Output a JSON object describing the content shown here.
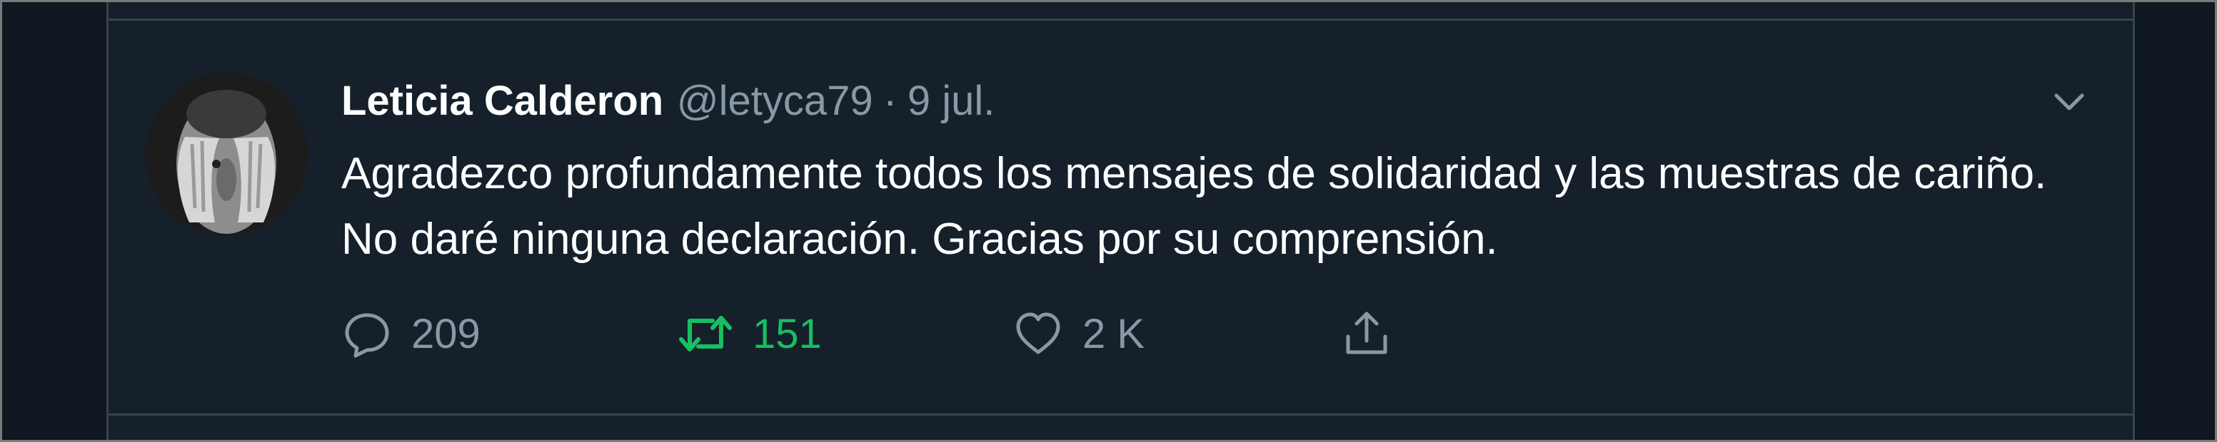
{
  "tweet": {
    "author_name": "Leticia Calderon",
    "handle": "@letyca79",
    "separator": "·",
    "date": "9 jul.",
    "text": "Agradezco profundamente todos los mensajes de solidaridad y las muestras de cariño. No daré ninguna declaración. Gracias por su comprensión."
  },
  "actions": {
    "reply": {
      "icon": "reply-icon",
      "count": "209",
      "color": "#8899a6"
    },
    "retweet": {
      "icon": "retweet-icon",
      "count": "151",
      "color": "#17bf63"
    },
    "like": {
      "icon": "heart-icon",
      "count": "2 K",
      "color": "#8899a6"
    },
    "share": {
      "icon": "share-icon"
    }
  },
  "menu": {
    "icon": "chevron-down-icon"
  },
  "theme": {
    "background": "#15202b",
    "text": "#ffffff",
    "muted": "#8899a6",
    "border": "#38444d"
  }
}
